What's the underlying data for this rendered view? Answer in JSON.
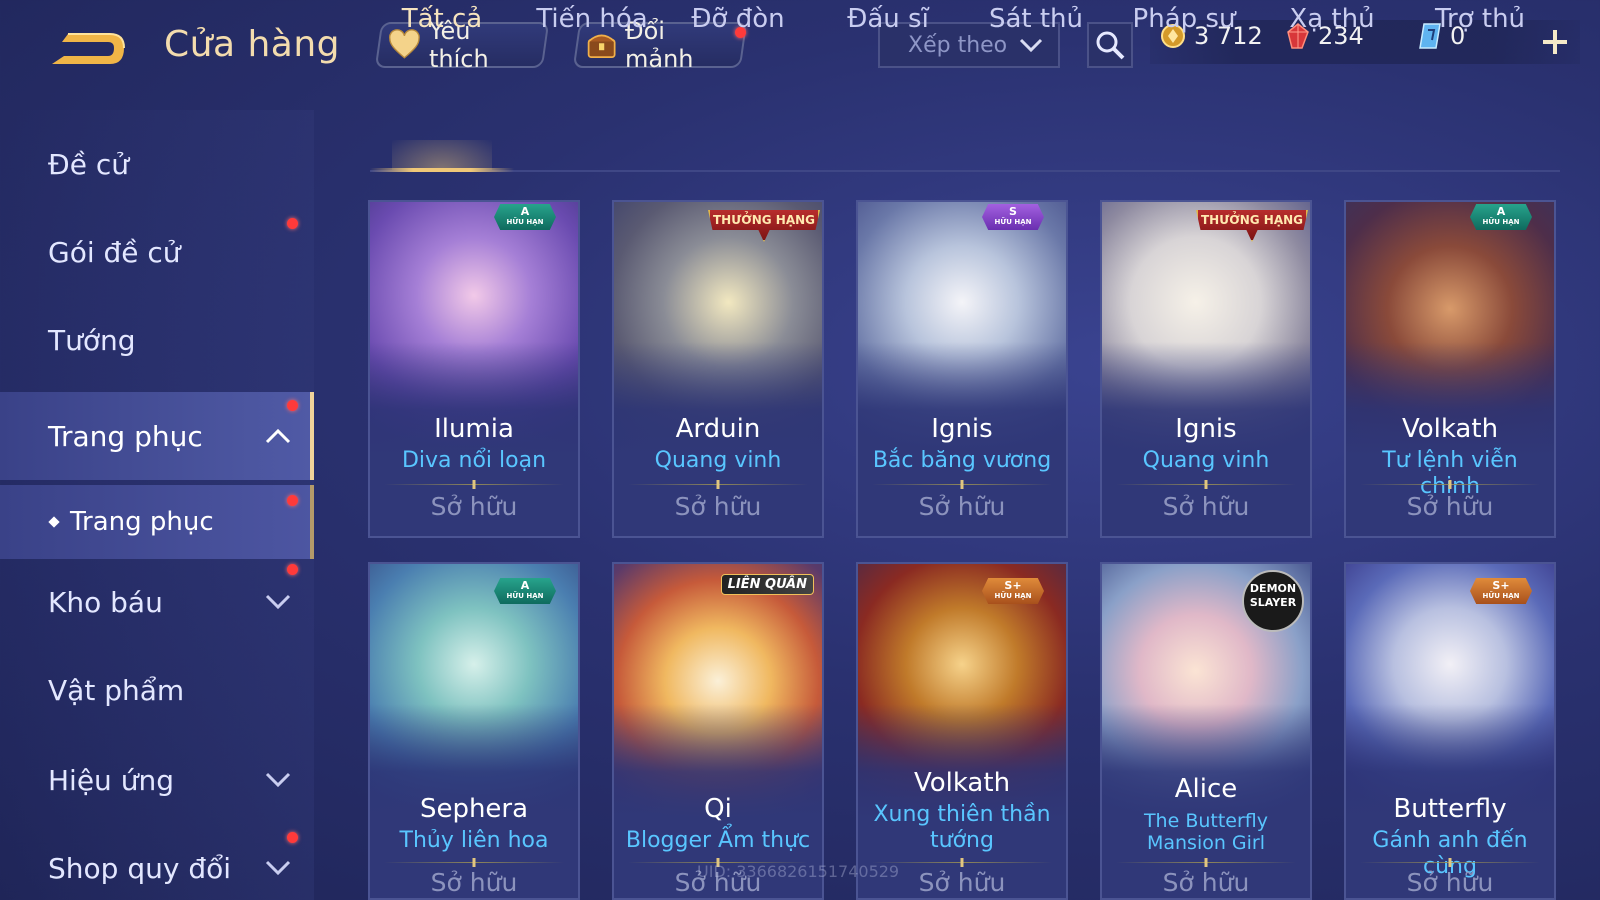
{
  "header": {
    "title": "Cửa hàng",
    "favorite_label": "Yêu thích",
    "shard_label": "Đổi mảnh",
    "sort_label": "Xếp theo",
    "currencies": {
      "gold": "3 712",
      "ruby": "234",
      "voucher": "0"
    }
  },
  "sidebar": {
    "items": [
      {
        "label": "Đề cử"
      },
      {
        "label": "Gói đề cử"
      },
      {
        "label": "Tướng"
      },
      {
        "label": "Trang phục"
      },
      {
        "label": "Kho báu"
      },
      {
        "label": "Vật phẩm"
      },
      {
        "label": "Hiệu ứng"
      },
      {
        "label": "Shop quy đổi"
      }
    ],
    "sub_item": "Trang phục"
  },
  "tabs": [
    "Tất cả",
    "Tiến hóa",
    "Đỡ đòn",
    "Đấu sĩ",
    "Sát thủ",
    "Pháp sư",
    "Xạ thủ",
    "Trợ thủ"
  ],
  "cards": [
    {
      "hero": "Ilumia",
      "skin": "Diva nổi loạn",
      "status": "Sở hữu",
      "badge": {
        "tier": "A",
        "label": "HỮU HẠN"
      }
    },
    {
      "hero": "Arduin",
      "skin": "Quang vinh",
      "status": "Sở hữu",
      "badge": {
        "label": "THƯỞNG HẠNG"
      }
    },
    {
      "hero": "Ignis",
      "skin": "Bắc băng vương",
      "status": "Sở hữu",
      "badge": {
        "tier": "S",
        "label": "HỮU HẠN"
      }
    },
    {
      "hero": "Ignis",
      "skin": "Quang vinh",
      "status": "Sở hữu",
      "badge": {
        "label": "THƯỞNG HẠNG"
      }
    },
    {
      "hero": "Volkath",
      "skin": "Tư lệnh viễn chinh",
      "status": "Sở hữu",
      "badge": {
        "tier": "A",
        "label": "HỮU HẠN"
      }
    },
    {
      "hero": "Sephera",
      "skin": "Thủy liên hoa",
      "status": "Sở hữu",
      "badge": {
        "tier": "A",
        "label": "HỮU HẠN"
      }
    },
    {
      "hero": "Qi",
      "skin": "Blogger Ẩm thực",
      "status": "Sở hữu",
      "badge": {
        "label": "LIÊN QUÂN"
      }
    },
    {
      "hero": "Volkath",
      "skin": "Xung thiên thần tướng",
      "status": "Sở hữu",
      "badge": {
        "tier": "S+",
        "label": "HỮU HẠN"
      }
    },
    {
      "hero": "Alice",
      "skin": "The Butterfly Mansion Girl",
      "status": "Sở hữu",
      "badge": {
        "label": "DEMON SLAYER"
      }
    },
    {
      "hero": "Butterfly",
      "skin": "Gánh anh đến cùng",
      "status": "Sở hữu",
      "badge": {
        "tier": "S+",
        "label": "HỮU HẠN"
      }
    }
  ],
  "colors": {
    "accent_gold": "#f3dcae",
    "skin_name": "#59c6ff",
    "notification": "#ff3a3a"
  },
  "uid_watermark": "UID: 3366826151740529"
}
